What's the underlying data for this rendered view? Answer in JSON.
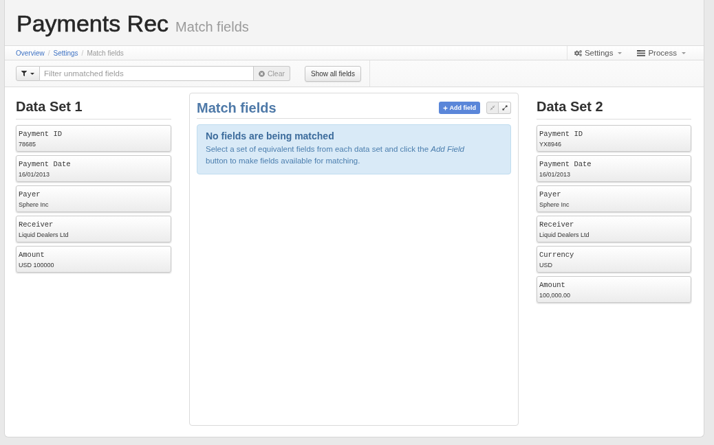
{
  "header": {
    "title": "Payments Rec",
    "subtitle": "Match fields"
  },
  "breadcrumb": {
    "items": [
      {
        "label": "Overview",
        "current": false
      },
      {
        "separator": "/",
        "label": "Settings",
        "current": false
      },
      {
        "separator": "/",
        "label": "Match fields",
        "current": true
      }
    ]
  },
  "menus": [
    {
      "kind": "settings",
      "label": "Settings"
    },
    {
      "kind": "process",
      "label": "Process"
    }
  ],
  "toolbar": {
    "filter": {
      "placeholder": "Filter unmatched fields"
    },
    "clear_button": "Clear",
    "show_all_button": "Show all fields"
  },
  "data_set_1": {
    "title": "Data Set 1",
    "fields": [
      {
        "label": "Payment ID",
        "value": "78685"
      },
      {
        "label": "Payment Date",
        "value": "16/01/2013"
      },
      {
        "label": "Payer",
        "value": "Sphere Inc"
      },
      {
        "label": "Receiver",
        "value": "Liquid Dealers Ltd"
      },
      {
        "label": "Amount",
        "value": "USD 100000"
      }
    ]
  },
  "match_panel": {
    "title": "Match fields",
    "add_button": "Add field",
    "view_buttons": [
      {
        "kind": "compress",
        "disabled": true
      },
      {
        "kind": "expand",
        "disabled": false
      }
    ],
    "alert": {
      "heading": "No fields are being matched",
      "text": "Select a set of equivalent fields from each data set and click the *Add Field* button to make fields available for matching."
    }
  },
  "data_set_2": {
    "title": "Data Set 2",
    "fields": [
      {
        "label": "Payment ID",
        "value": "YX8946"
      },
      {
        "label": "Payment Date",
        "value": "16/01/2013"
      },
      {
        "label": "Payer",
        "value": "Sphere Inc"
      },
      {
        "label": "Receiver",
        "value": "Liquid Dealers Ltd"
      },
      {
        "label": "Currency",
        "value": "USD"
      },
      {
        "label": "Amount",
        "value": "100,000.00"
      }
    ]
  }
}
